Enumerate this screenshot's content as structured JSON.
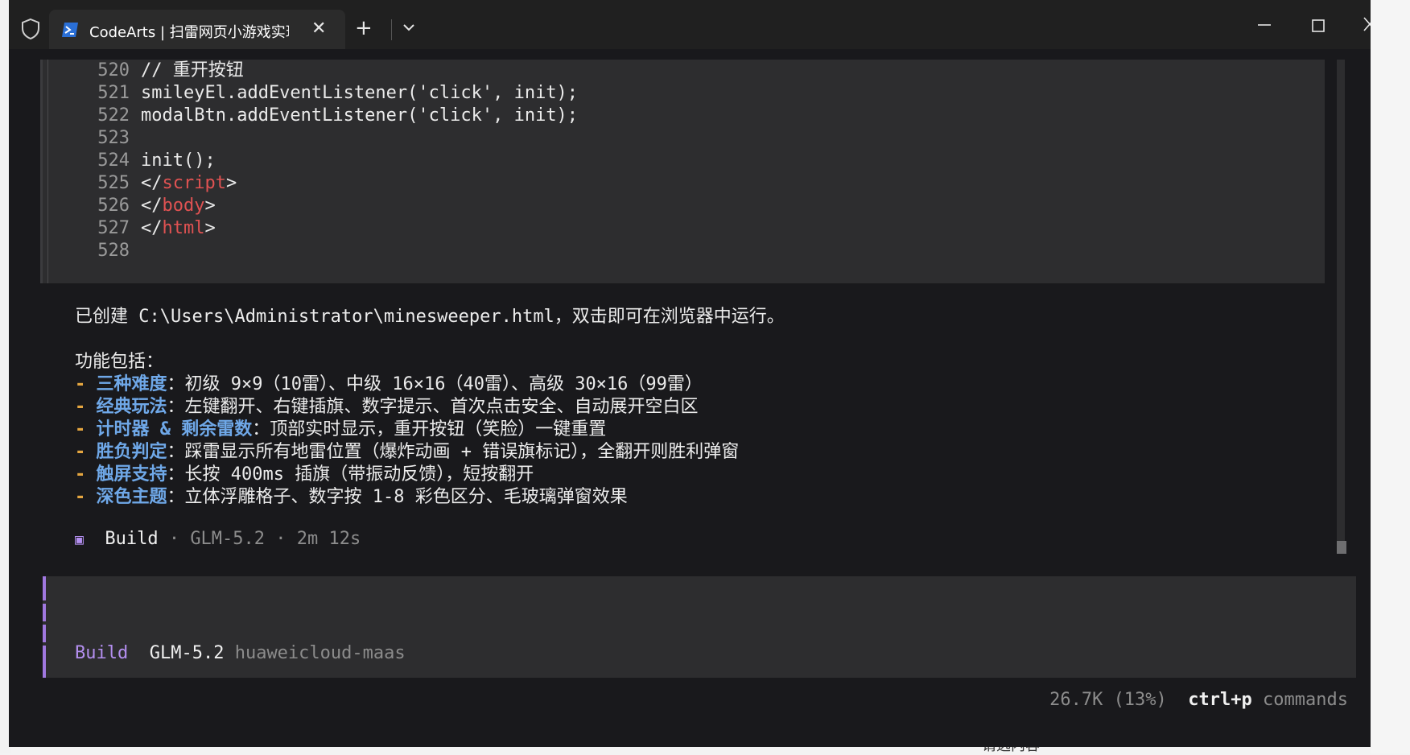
{
  "window": {
    "tab_title": "CodeArts | 扫雷网页小游戏实现",
    "icons": {
      "shield": "shield-icon",
      "tab": "powershell-icon",
      "close_tab": "close-icon",
      "new_tab": "plus-icon",
      "tab_menu": "chevron-down-icon",
      "minimize": "minimize-icon",
      "maximize": "maximize-icon",
      "close": "close-icon"
    },
    "close_glyph": "✕",
    "new_tab_glyph": "+"
  },
  "code": {
    "lines": [
      {
        "num": "520",
        "text": "// 重开按钮"
      },
      {
        "num": "521",
        "text": "smileyEl.addEventListener('click', init);"
      },
      {
        "num": "522",
        "text": "modalBtn.addEventListener('click', init);"
      },
      {
        "num": "523",
        "text": ""
      },
      {
        "num": "524",
        "text": "init();"
      },
      {
        "num": "525",
        "pre": "</",
        "tag": "script",
        "post": ">"
      },
      {
        "num": "526",
        "pre": "</",
        "tag": "body",
        "post": ">"
      },
      {
        "num": "527",
        "pre": "</",
        "tag": "html",
        "post": ">"
      },
      {
        "num": "528",
        "text": ""
      }
    ]
  },
  "message": {
    "created": "已创建 C:\\Users\\Administrator\\minesweeper.html，双击即可在浏览器中运行。",
    "features_heading": "功能包括：",
    "bullet": "- ",
    "features": [
      {
        "title": "三种难度",
        "desc": "：初级 9×9（10雷）、中级 16×16（40雷）、高级 30×16（99雷）"
      },
      {
        "title": "经典玩法",
        "desc": "：左键翻开、右键插旗、数字提示、首次点击安全、自动展开空白区"
      },
      {
        "title": "计时器 & 剩余雷数",
        "desc": "：顶部实时显示，重开按钮（笑脸）一键重置"
      },
      {
        "title": "胜负判定",
        "desc": "：踩雷显示所有地雷位置（爆炸动画 + 错误旗标记），全翻开则胜利弹窗"
      },
      {
        "title": "触屏支持",
        "desc": "：长按 400ms 插旗（带振动反馈），短按翻开"
      },
      {
        "title": "深色主题",
        "desc": "：立体浮雕格子、数字按 1-8 彩色区分、毛玻璃弹窗效果"
      }
    ]
  },
  "build": {
    "icon": "▣",
    "label": "Build",
    "meta": " · GLM-5.2 · 2m 12s"
  },
  "input": {
    "agent": "Build",
    "model": "GLM-5.2",
    "provider": "huaweicloud-maas"
  },
  "footer": {
    "usage": "26.7K (13%)",
    "shortcut": "ctrl+p",
    "commands": "commands"
  },
  "colors": {
    "terminal_bg": "#19191c",
    "panel_bg": "#2d2d2f",
    "tag_red": "#e05252",
    "keyword_blue": "#6fa8e8",
    "bullet_orange": "#e5a640",
    "agent_purple": "#b48ff0"
  },
  "background": {
    "bottom_text": "请选内容"
  }
}
